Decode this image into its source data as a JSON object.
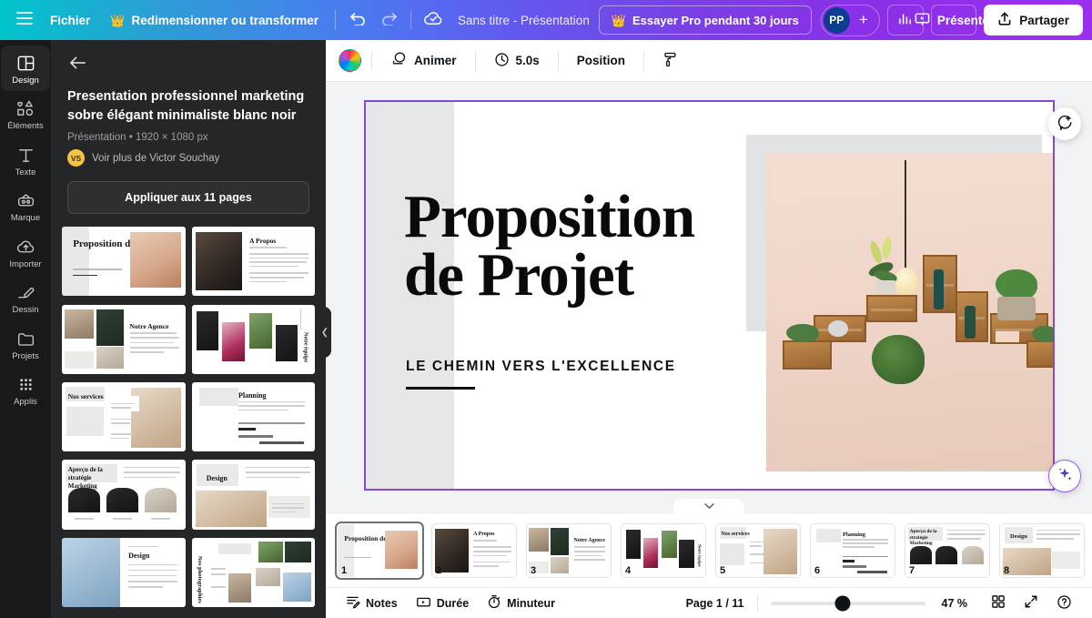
{
  "topbar": {
    "menu_icon": "hamburger-icon",
    "file_label": "Fichier",
    "resize_label": "Redimensionner ou transformer",
    "resize_badge": "crown-icon",
    "undo_icon": "undo-icon",
    "redo_icon": "redo-icon",
    "saved_icon": "cloud-check-icon",
    "doc_title": "Sans titre - Présentation",
    "pro_label": "Essayer Pro pendant 30 jours",
    "pro_badge": "crown-icon",
    "avatar_initials": "PP",
    "avatar_add": "+",
    "insights_icon": "bar-chart-icon",
    "present_label": "Présenter",
    "present_icon": "present-screen-icon",
    "share_label": "Partager",
    "share_icon": "share-upload-icon",
    "accent_start": "#00c4cc",
    "accent_mid": "#5b7cf5",
    "accent_end": "#9b2ff0"
  },
  "rail": {
    "items": [
      {
        "label": "Design",
        "icon": "design-layout-icon",
        "active": true
      },
      {
        "label": "Éléments",
        "icon": "elements-shapes-icon",
        "active": false
      },
      {
        "label": "Texte",
        "icon": "text-t-icon",
        "active": false
      },
      {
        "label": "Marque",
        "icon": "brand-icon",
        "active": false
      },
      {
        "label": "Importer",
        "icon": "upload-cloud-icon",
        "active": false
      },
      {
        "label": "Dessin",
        "icon": "draw-pen-icon",
        "active": false
      },
      {
        "label": "Projets",
        "icon": "folder-icon",
        "active": false
      },
      {
        "label": "Applis",
        "icon": "apps-grid-icon",
        "active": false
      }
    ]
  },
  "panel": {
    "back_icon": "arrow-left-icon",
    "title": "Presentation professionnel marketing sobre élégant minimaliste blanc noir",
    "meta": "Présentation • 1920 × 1080 px",
    "author_initials": "VS",
    "author_link": "Voir plus de Victor Souchay",
    "apply_label": "Appliquer aux 11 pages",
    "collapse_icon": "chevron-left-icon",
    "templates": [
      {
        "n": 1,
        "title": "Proposition de Projet"
      },
      {
        "n": 2,
        "title": "A Propos"
      },
      {
        "n": 3,
        "title": "Notre Agence"
      },
      {
        "n": 4,
        "title": "Notre équipe"
      },
      {
        "n": 5,
        "title": "Nos services"
      },
      {
        "n": 6,
        "title": "Planning"
      },
      {
        "n": 7,
        "title": "Aperçu de la stratégie Marketing"
      },
      {
        "n": 8,
        "title": "Design"
      },
      {
        "n": 9,
        "title": "Design"
      },
      {
        "n": 10,
        "title": "Nos photographies"
      }
    ]
  },
  "editor_toolbar": {
    "color_swatch": "rainbow-color-icon",
    "animate_label": "Animer",
    "animate_icon": "animate-icon",
    "duration_value": "5.0s",
    "duration_icon": "clock-icon",
    "position_label": "Position",
    "style_icon": "paint-roller-icon"
  },
  "canvas": {
    "slide_title_line1": "Proposition",
    "slide_title_line2": "de Projet",
    "slide_subtitle": "LE CHEMIN VERS L'EXCELLENCE",
    "comment_fab": "add-comment-icon",
    "magic_fab": "magic-sparkle-icon",
    "selection_color": "#7d4cdb"
  },
  "strip": {
    "handle_icon": "chevron-down-icon",
    "thumbs": [
      {
        "num": "1",
        "title": "Proposition de Projet",
        "selected": true
      },
      {
        "num": "2",
        "title": "A Propos",
        "selected": false
      },
      {
        "num": "3",
        "title": "Notre Agence",
        "selected": false
      },
      {
        "num": "4",
        "title": "Notre équipe",
        "selected": false
      },
      {
        "num": "5",
        "title": "Nos services",
        "selected": false
      },
      {
        "num": "6",
        "title": "Planning",
        "selected": false
      },
      {
        "num": "7",
        "title": "Aperçu de la stratégie Marketing",
        "selected": false
      },
      {
        "num": "8",
        "title": "Design",
        "selected": false
      }
    ]
  },
  "statusbar": {
    "notes_label": "Notes",
    "notes_icon": "notes-icon",
    "duration_label": "Durée",
    "duration_icon": "duration-icon",
    "timer_label": "Minuteur",
    "timer_icon": "timer-icon",
    "page_indicator": "Page 1 / 11",
    "zoom_value": "47 %",
    "zoom_percent": 47,
    "grid_icon": "grid-view-icon",
    "fullscreen_icon": "expand-icon",
    "help_icon": "help-circle-icon"
  }
}
